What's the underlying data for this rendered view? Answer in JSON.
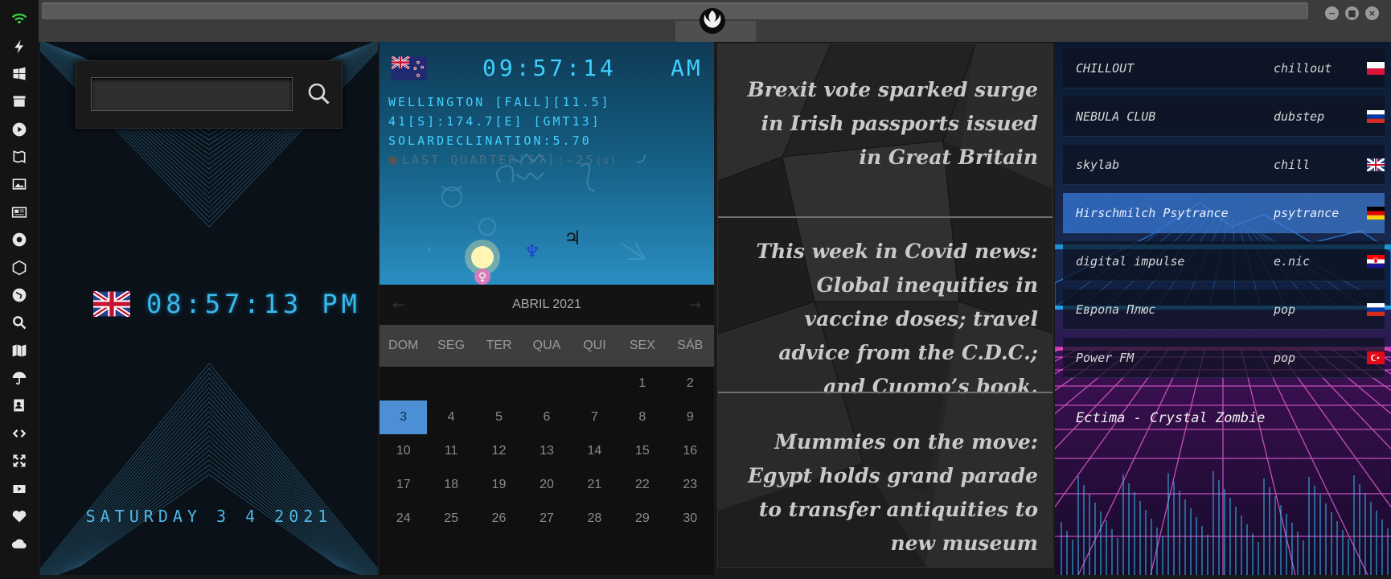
{
  "search": {
    "placeholder": "",
    "value": ""
  },
  "uk_clock": {
    "time": "08:57:13 PM",
    "date": "SATURDAY 3 4 2021"
  },
  "nz": {
    "time": "09:57:14",
    "ampm": "AM",
    "location": "WELLINGTON [FALL][11.5]",
    "coords": "41[S]:174.7[E] [GMT13]",
    "solar": "SOLARDECLINATION:5.70",
    "moon": "LAST QUARTER[57]:-25",
    "moon_suffix": "(s)"
  },
  "calendar": {
    "title": "ABRIL 2021",
    "prev": "←",
    "next": "→",
    "weekdays": [
      "DOM",
      "SEG",
      "TER",
      "QUA",
      "QUI",
      "SEX",
      "SÁB"
    ],
    "leading_blanks": 5,
    "days": [
      "1",
      "2",
      "3",
      "4",
      "5",
      "6",
      "7",
      "8",
      "9",
      "10",
      "11",
      "12",
      "13",
      "14",
      "15",
      "16",
      "17",
      "18",
      "19",
      "20",
      "21",
      "22",
      "23",
      "24",
      "25",
      "26",
      "27",
      "28",
      "29",
      "30"
    ],
    "today": "3"
  },
  "news": [
    "Brexit vote sparked surge in Irish passports issued in Great Britain",
    "This week in Covid news: Global inequities in vaccine doses; travel advice from the C.D.C.; and Cuomo’s book.",
    "Mummies on the move: Egypt holds grand parade to transfer antiquities to new museum"
  ],
  "radio": {
    "stations": [
      {
        "name": "CHILLOUT",
        "genre": "chillout",
        "flag": "poland-flag",
        "active": false
      },
      {
        "name": "NEBULA CLUB",
        "genre": "dubstep",
        "flag": "russia-flag",
        "active": false
      },
      {
        "name": "skylab",
        "genre": "chill",
        "flag": "uk-flag",
        "active": false
      },
      {
        "name": "Hirschmilch Psytrance",
        "genre": "psytrance",
        "flag": "germany-flag",
        "active": true
      },
      {
        "name": "digital impulse",
        "genre": "e.nic",
        "flag": "croatia-flag",
        "active": false
      },
      {
        "name": "Европа Плюс",
        "genre": "pop",
        "flag": "russia-flag",
        "active": false
      },
      {
        "name": "Power FM",
        "genre": "pop",
        "flag": "turkey-flag",
        "active": false
      }
    ],
    "now_playing": "Ectima - Crystal Zombie"
  },
  "window_controls": {
    "minimize": "−",
    "maximize": "■",
    "close": "×"
  },
  "colors": {
    "accent": "#39b9ee",
    "today": "#4d8fd4",
    "rail": "#141414"
  }
}
